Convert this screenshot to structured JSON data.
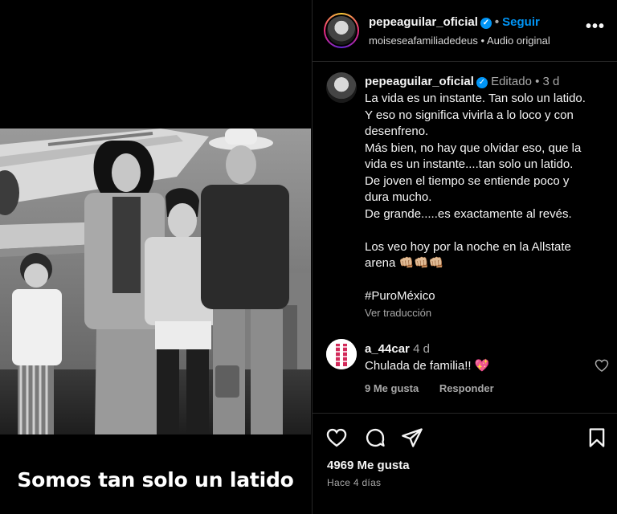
{
  "media": {
    "overlay_caption": "Somos tan solo un latido",
    "photo_alt": "Black and white family photo in front of an airplane"
  },
  "header": {
    "username": "pepeaguilar_oficial",
    "separator": "•",
    "follow_label": "Seguir",
    "subline_account": "moiseseafamiliadedeus",
    "subline_separator": "•",
    "subline_audio": "Audio original",
    "more_label": "•••"
  },
  "caption": {
    "username": "pepeaguilar_oficial",
    "edited": "Editado",
    "separator": "•",
    "age": "3 d",
    "lines": [
      "La vida es un instante. Tan solo un latido.",
      "Y eso no significa vivirla a lo loco y con",
      "desenfreno.",
      "Más bien, no hay que olvidar eso, que la",
      "vida es un instante....tan solo un latido.",
      "De joven el tiempo se entiende poco y",
      "dura mucho.",
      "De grande.....es exactamente al revés.",
      "",
      "Los veo hoy por la noche en la Allstate",
      "arena 👊🏼👊🏼👊🏼",
      "",
      "#PuroMéxico"
    ],
    "translate": "Ver traducción"
  },
  "comment": {
    "username": "a_44car",
    "age": "4 d",
    "text": "Chulada de familia!! 💖",
    "likes": "9 Me gusta",
    "reply": "Responder"
  },
  "footer": {
    "likes": "4969 Me gusta",
    "time": "Hace 4 días"
  },
  "colors": {
    "accent": "#0095f6",
    "muted": "#a8a8a8",
    "divider": "#262626",
    "background": "#000000"
  },
  "icons": [
    "verified-badge",
    "more-icon",
    "heart-icon",
    "comment-icon",
    "share-icon",
    "bookmark-icon"
  ]
}
